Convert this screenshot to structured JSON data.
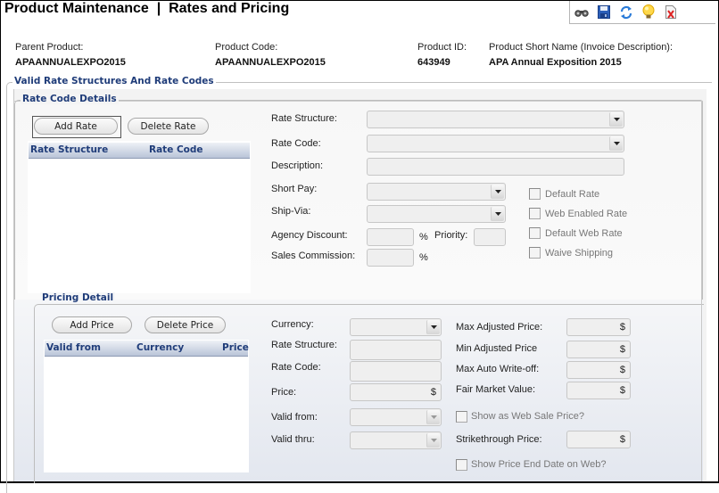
{
  "header": {
    "title": "Product Maintenance  |  Rates and Pricing",
    "toolbar_icons": [
      "binoculars-icon",
      "save-icon",
      "refresh-icon",
      "lightbulb-icon",
      "report-icon"
    ]
  },
  "product_info": {
    "parent_product_label": "Parent Product:",
    "parent_product_value": "APAANNUALEXPO2015",
    "product_code_label": "Product Code:",
    "product_code_value": "APAANNUALEXPO2015",
    "product_id_label": "Product ID:",
    "product_id_value": "643949",
    "short_name_label": "Product Short Name (Invoice Description):",
    "short_name_value": "APA Annual Exposition 2015"
  },
  "valid_rates_section": {
    "title": "Valid Rate Structures And Rate Codes"
  },
  "rate_code_details": {
    "title": "Rate Code Details",
    "add_button": "Add Rate",
    "delete_button": "Delete Rate",
    "grid_columns": [
      "Rate Structure",
      "Rate Code"
    ],
    "grid_rows": [],
    "fields": {
      "rate_structure_label": "Rate Structure:",
      "rate_structure_value": "",
      "rate_code_label": "Rate Code:",
      "rate_code_value": "",
      "description_label": "Description:",
      "description_value": "",
      "short_pay_label": "Short Pay:",
      "short_pay_value": "",
      "ship_via_label": "Ship-Via:",
      "ship_via_value": "",
      "agency_discount_label": "Agency Discount:",
      "agency_discount_value": "",
      "percent_symbol": "%",
      "priority_label": "Priority:",
      "priority_value": "",
      "sales_commission_label": "Sales Commission:",
      "sales_commission_value": ""
    },
    "checkboxes": [
      {
        "label": "Default Rate",
        "checked": false
      },
      {
        "label": "Web Enabled Rate",
        "checked": false
      },
      {
        "label": "Default Web Rate",
        "checked": false
      },
      {
        "label": "Waive Shipping",
        "checked": false
      }
    ]
  },
  "pricing_detail": {
    "title": "Pricing Detail",
    "add_button": "Add Price",
    "delete_button": "Delete Price",
    "grid_columns": [
      "Valid from",
      "Currency",
      "Price"
    ],
    "grid_rows": [],
    "fields": {
      "currency_label": "Currency:",
      "currency_value": "",
      "rate_structure_label": "Rate Structure:",
      "rate_structure_value": "",
      "rate_code_label": "Rate Code:",
      "rate_code_value": "",
      "price_label": "Price:",
      "price_value": "",
      "valid_from_label": "Valid from:",
      "valid_from_value": "",
      "valid_thru_label": "Valid thru:",
      "valid_thru_value": "",
      "max_adjusted_label": "Max Adjusted Price:",
      "min_adjusted_label": "Min Adjusted Price",
      "max_writeoff_label": "Max Auto Write-off:",
      "fair_market_label": "Fair Market Value:",
      "strikethrough_label": "Strikethrough Price:",
      "currency_symbol": "$"
    },
    "checkboxes": [
      {
        "label": "Show as Web Sale Price?",
        "checked": false
      },
      {
        "label": "Show Price End Date on Web?",
        "checked": false
      }
    ]
  }
}
